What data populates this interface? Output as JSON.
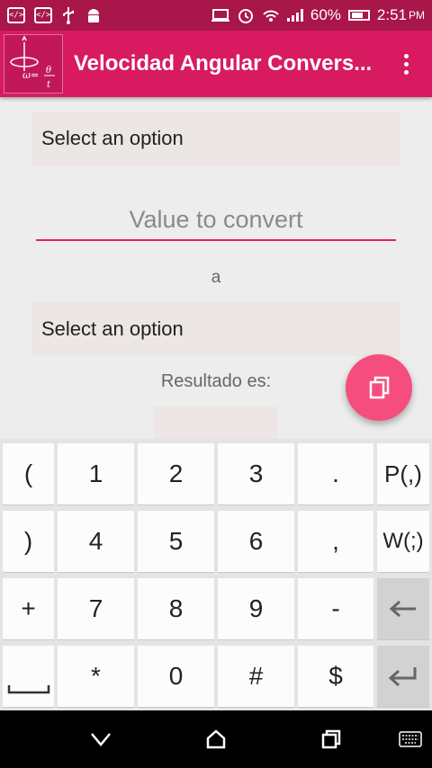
{
  "status_bar": {
    "battery": "60%",
    "time": "2:51",
    "ampm": "PM",
    "icons": [
      "code-notification-icon",
      "code-notification-icon",
      "usb-icon",
      "android-icon",
      "cast-icon",
      "alarm-icon",
      "wifi-icon",
      "signal-icon",
      "battery-icon"
    ]
  },
  "app_bar": {
    "title": "Velocidad Angular Convers..."
  },
  "form": {
    "from_spinner": "Select an option",
    "value_placeholder": "Value to convert",
    "connector": "a",
    "to_spinner": "Select an option",
    "result_label": "Resultado es:",
    "result_value": ""
  },
  "keyboard": {
    "rows": [
      [
        "(",
        "1",
        "2",
        "3",
        ".",
        "P(,)"
      ],
      [
        ")",
        "4",
        "5",
        "6",
        ",",
        "W(;)"
      ],
      [
        "+",
        "7",
        "8",
        "9",
        "-",
        ""
      ],
      [
        "",
        "*",
        "0",
        "#",
        "$",
        ""
      ]
    ],
    "special": {
      "backspace_icon": "backspace-icon",
      "enter_icon": "enter-icon",
      "space_icon": "space-icon"
    }
  },
  "nav_bar": {
    "icons": [
      "back-icon",
      "home-icon",
      "recents-icon",
      "keyboard-switch-icon"
    ]
  },
  "colors": {
    "status_bar": "#a8164a",
    "app_bar": "#d81b60",
    "accent": "#e91e63",
    "fab": "#f54d7d",
    "background": "#ededed"
  }
}
